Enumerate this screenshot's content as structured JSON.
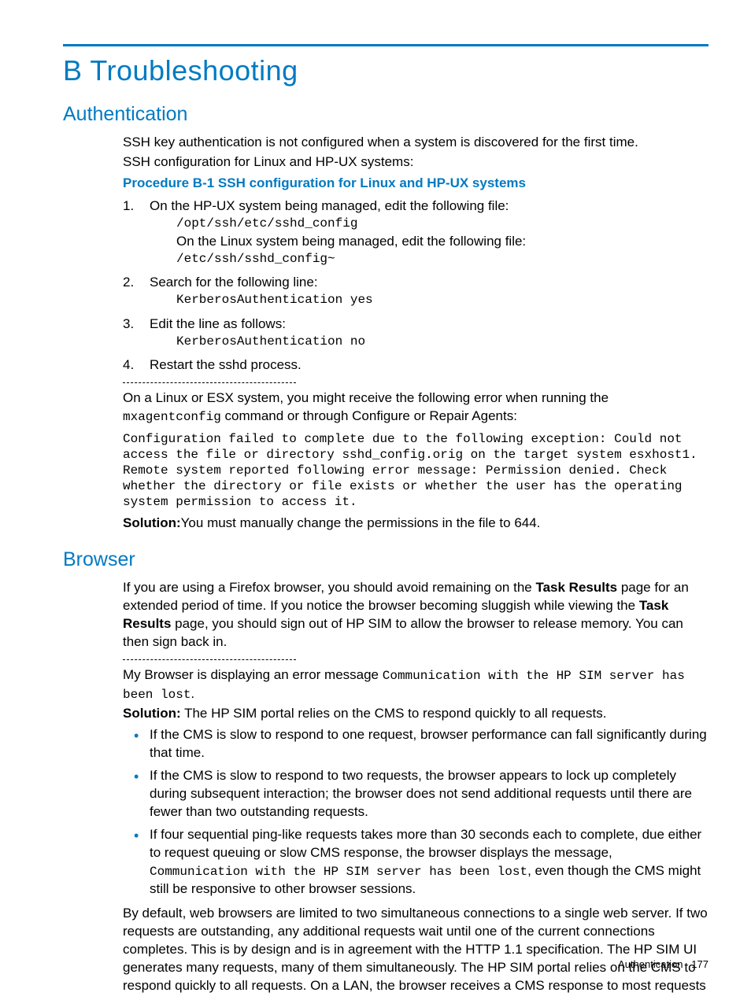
{
  "title": "B Troubleshooting",
  "sectionA": {
    "heading": "Authentication",
    "intro1": "SSH key authentication is not configured when a system is discovered for the first time.",
    "intro2": "SSH configuration for Linux and HP-UX systems:",
    "procTitle": "Procedure B-1 SSH configuration for Linux and HP-UX systems",
    "steps": [
      {
        "num": "1.",
        "line": "On the HP-UX system being managed, edit the following file:",
        "code1": "/opt/ssh/etc/sshd_config",
        "line2": "On the Linux system being managed, edit the following file:",
        "code2": "/etc/ssh/sshd_config~"
      },
      {
        "num": "2.",
        "line": "Search for the following line:",
        "code1": "KerberosAuthentication yes"
      },
      {
        "num": "3.",
        "line": "Edit the line as follows:",
        "code1": "KerberosAuthentication no"
      },
      {
        "num": "4.",
        "line": "Restart the sshd process."
      }
    ],
    "para_pre": "On a Linux or ESX system, you might receive the following error when running the ",
    "para_mono": "mxagentconfig",
    "para_post": " command or through Configure or Repair Agents:",
    "errblock": "Configuration failed to complete due to the following exception: Could not access the file or directory sshd_config.orig on the target system esxhost1. Remote system reported following error message: Permission denied. Check whether the directory or file exists or whether the user has the operating system permission to access it.",
    "sol_label": "Solution:",
    "sol_text": "You must manually change the permissions in the file to 644."
  },
  "sectionB": {
    "heading": "Browser",
    "p1_a": "If you are using a Firefox browser, you should avoid remaining on the ",
    "p1_b": "Task Results",
    "p1_c": " page for an extended period of time. If you notice the browser becoming sluggish while viewing the ",
    "p1_d": "Task Results",
    "p1_e": " page, you should sign out of HP SIM to allow the browser to release memory. You can then sign back in.",
    "p2_a": "My Browser is displaying an error message ",
    "p2_mono": "Communication with the HP SIM server has been lost",
    "p2_b": ".",
    "sol_label": "Solution:",
    "sol_text": " The HP SIM portal relies on the CMS to respond quickly to all requests.",
    "bullets": [
      "If the CMS is slow to respond to one request, browser performance can fall significantly during that time.",
      "If the CMS is slow to respond to two requests, the browser appears to lock up completely during subsequent interaction; the browser does not send additional requests until there are fewer than two outstanding requests."
    ],
    "bullet3_a": "If four sequential ping-like requests takes more than 30 seconds each to complete, due either to request queuing or slow CMS response, the browser displays the message, ",
    "bullet3_mono": "Communication with the HP SIM server has been lost",
    "bullet3_b": ", even though the CMS might still be responsive to other browser sessions.",
    "p3": "By default, web browsers are limited to two simultaneous connections to a single web server. If two requests are outstanding, any additional requests wait until one of the current connections completes. This is by design and is in agreement with the HTTP 1.1 specification. The HP SIM UI generates many requests, many of them simultaneously. The HP SIM portal relies on the CMS to respond quickly to all requests. On a LAN, the browser receives a CMS response to most requests"
  },
  "footer": {
    "section": "Authentication",
    "page": "177"
  }
}
